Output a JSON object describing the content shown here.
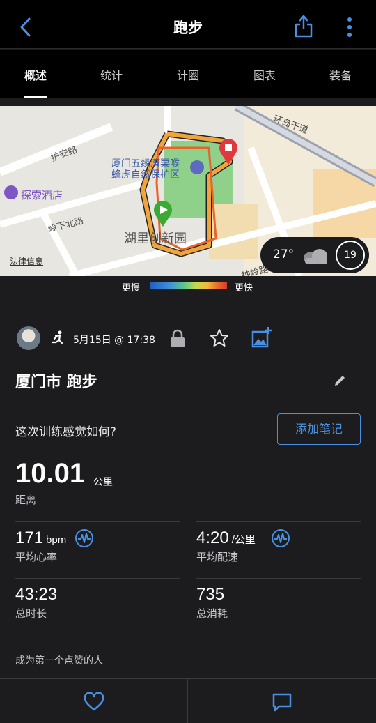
{
  "header": {
    "title": "跑步",
    "back_icon": "chevron-left-icon",
    "share_icon": "share-icon",
    "more_icon": "more-vertical-icon"
  },
  "tabs": [
    {
      "label": "概述",
      "active": true
    },
    {
      "label": "统计"
    },
    {
      "label": "计圈"
    },
    {
      "label": "图表"
    },
    {
      "label": "装备"
    }
  ],
  "map": {
    "labels": [
      "护安路",
      "厦门五缘湾栗喉",
      "蜂虎自然保护区",
      "探索酒店",
      "岭下北路",
      "护安路",
      "湖里创新园",
      "法律信息",
      "环岛干道",
      "环岛干",
      "墩岭路",
      "墩岭路",
      "钟岭路",
      "湖里创新园"
    ],
    "weather": {
      "temperature": "27°",
      "wind": "19"
    }
  },
  "pace_legend": {
    "slow": "更慢",
    "fast": "更快"
  },
  "activity": {
    "date": "5月15日 @ 17:38",
    "title": "厦门市 跑步",
    "feel_prompt": "这次训练感觉如何?",
    "add_note": "添加笔记",
    "distance": {
      "value": "10.01",
      "unit": "公里",
      "label": "距离"
    },
    "stats": {
      "heart_rate": {
        "value": "171",
        "unit": "bpm",
        "label": "平均心率"
      },
      "pace": {
        "value": "4:20",
        "unit": "/公里",
        "label": "平均配速"
      },
      "duration": {
        "value": "43:23",
        "label": "总时长"
      },
      "calories": {
        "value": "735",
        "label": "总消耗"
      }
    },
    "kudos": "成为第一个点赞的人"
  },
  "colors": {
    "accent": "#4a90e2",
    "background": "#1c1c1e",
    "bar": "#000000"
  }
}
